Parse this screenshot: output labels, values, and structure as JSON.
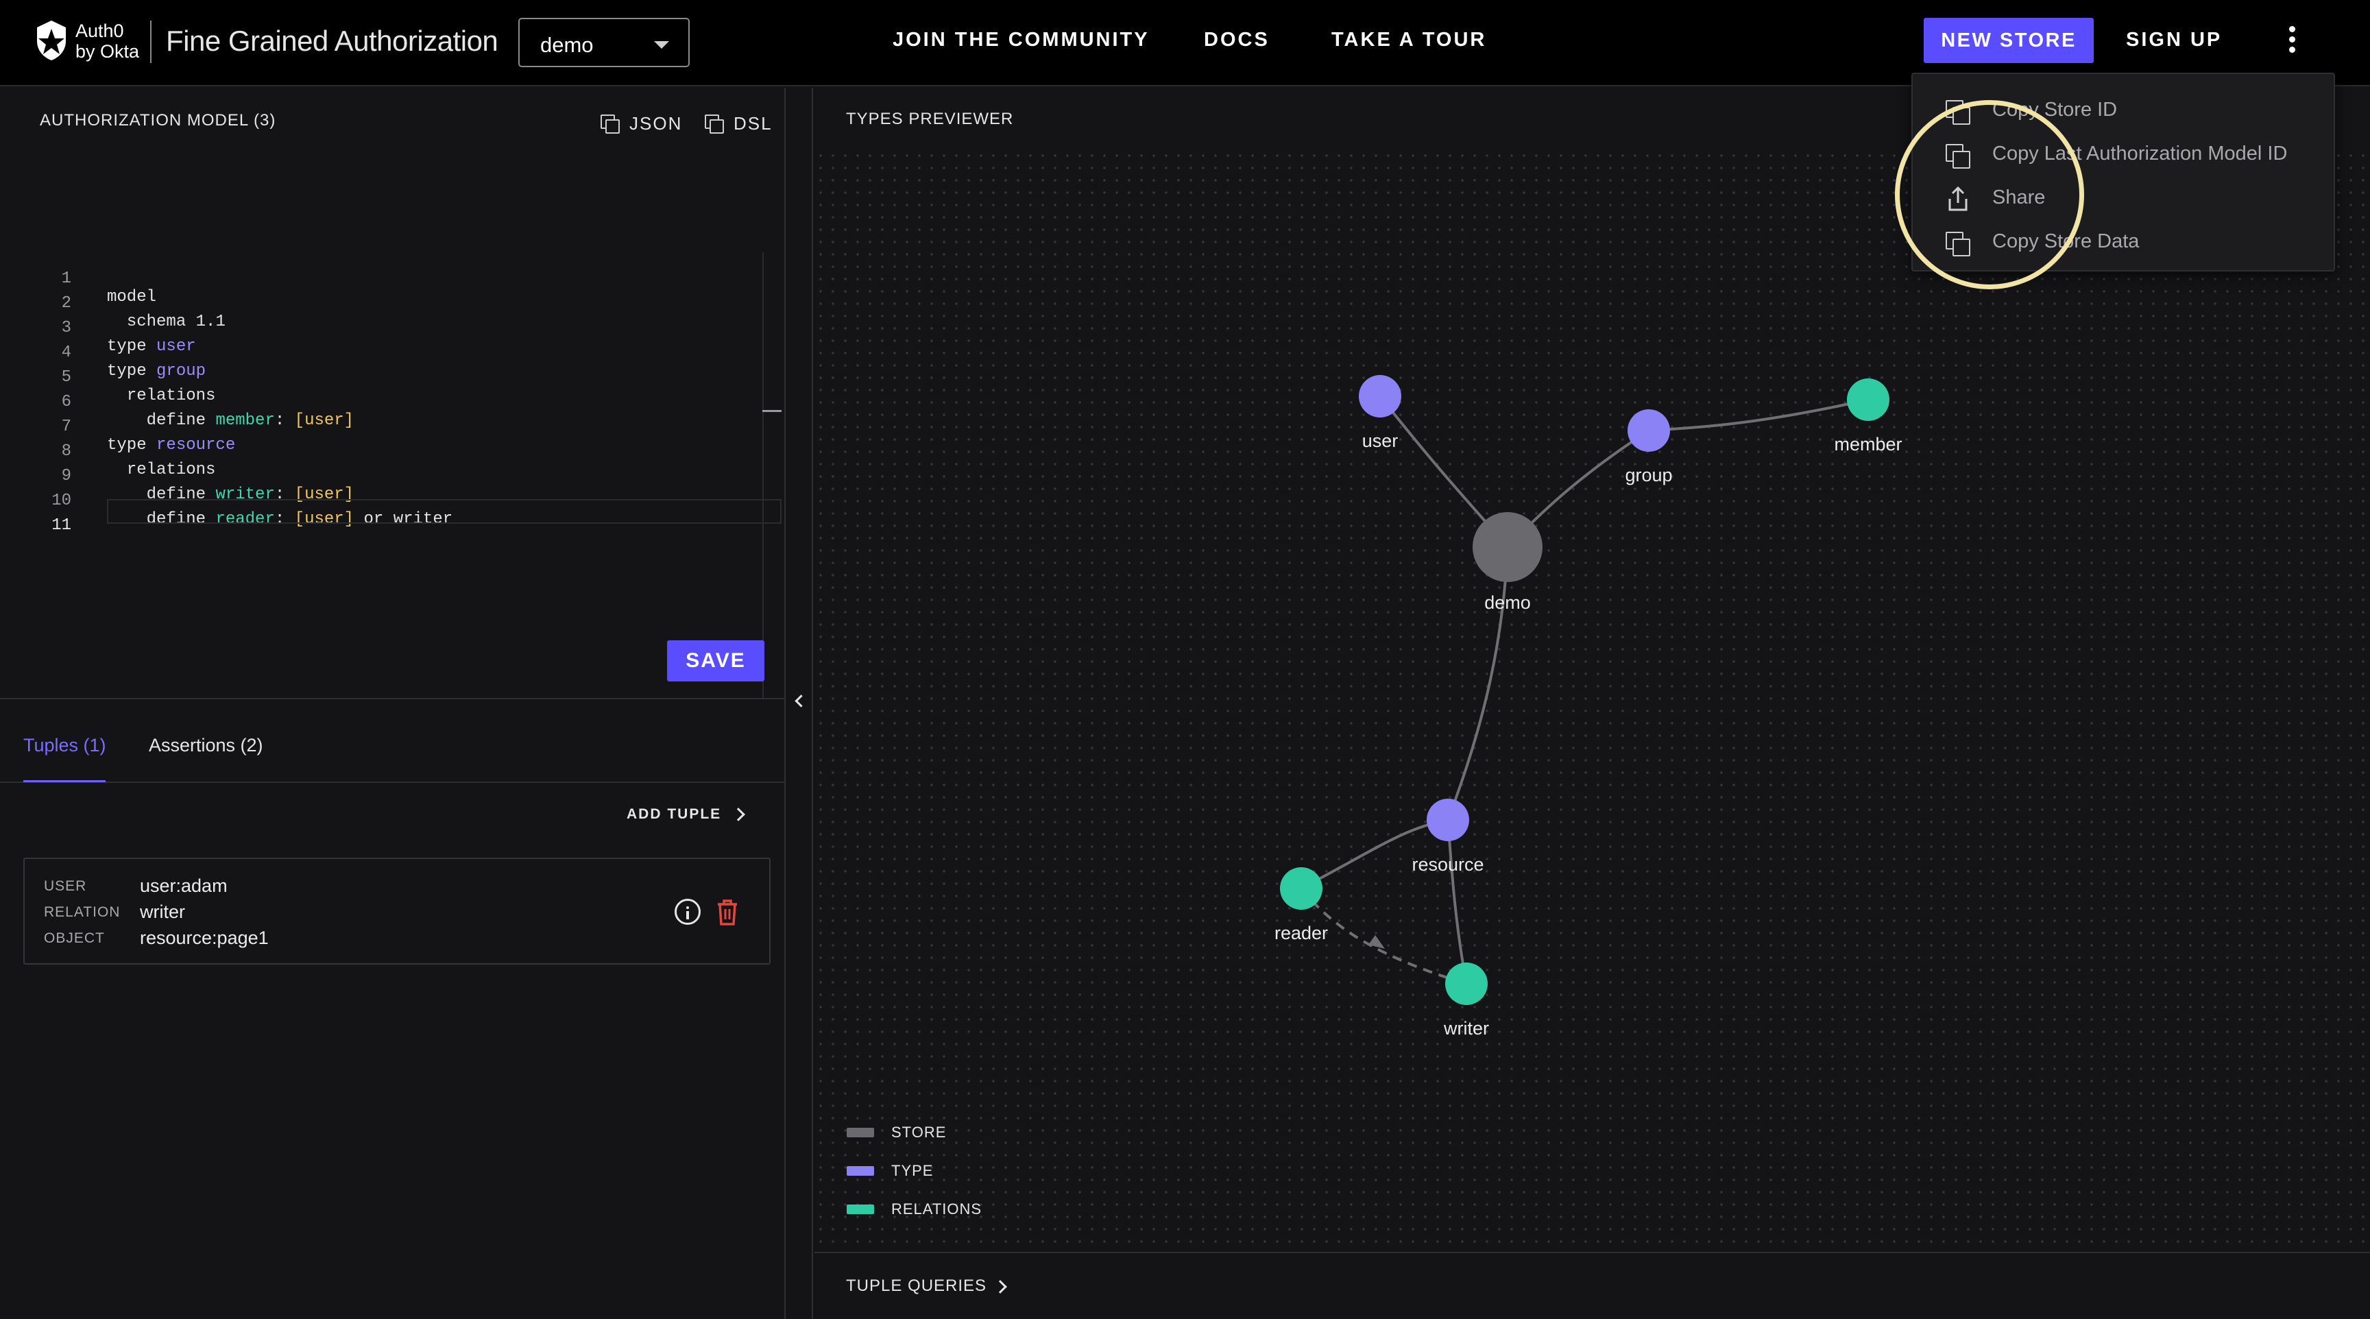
{
  "header": {
    "brand_line1": "Auth0",
    "brand_line2": "by Okta",
    "product_title": "Fine Grained Authorization",
    "store_selector_value": "demo",
    "nav": [
      "JOIN  THE COMMUNITY",
      "DOCS",
      "TAKE  A  TOUR"
    ],
    "new_store_label": "NEW STORE",
    "sign_up_label": "SIGN UP",
    "accent_color": "#5a4dff"
  },
  "model_panel": {
    "title": "AUTHORIZATION MODEL (3)",
    "json_label": "JSON",
    "dsl_label": "DSL",
    "line_numbers": [
      "1",
      "2",
      "3",
      "4",
      "5",
      "6",
      "7",
      "8",
      "9",
      "10",
      "11"
    ],
    "code": {
      "l1": "model",
      "l2_kw": "schema ",
      "l2_val": "1.1",
      "l3_kw": "type ",
      "l3_name": "user",
      "l4_kw": "type ",
      "l4_name": "group",
      "l5": "relations",
      "l6_kw": "define ",
      "l6_rel": "member",
      "l6_sep": ": ",
      "l6_val": "[user]",
      "l7_kw": "type ",
      "l7_name": "resource",
      "l8": "relations",
      "l9_kw": "define ",
      "l9_rel": "writer",
      "l9_sep": ": ",
      "l9_val": "[user]",
      "l10_kw": "define ",
      "l10_rel": "reader",
      "l10_sep": ": ",
      "l10_val": "[user]",
      "l10_rest": " or writer"
    },
    "save_label": "SAVE"
  },
  "tuples_panel": {
    "tab_tuples": "Tuples (1)",
    "tab_assertions": "Assertions (2)",
    "add_tuple_label": "ADD TUPLE",
    "tuple": {
      "user_label": "USER",
      "user_value": "user:adam",
      "relation_label": "RELATION",
      "relation_value": "writer",
      "object_label": "OBJECT",
      "object_value": "resource:page1"
    }
  },
  "types_previewer": {
    "title": "TYPES PREVIEWER",
    "colors": {
      "store": "#6a6a6e",
      "type": "#8a82f5",
      "relation": "#2fcca4",
      "edge": "#6f6f74"
    },
    "nodes": {
      "demo": "demo",
      "user": "user",
      "group": "group",
      "member": "member",
      "resource": "resource",
      "reader": "reader",
      "writer": "writer"
    },
    "legend": [
      "STORE",
      "TYPE",
      "RELATIONS"
    ],
    "tuple_queries_label": "TUPLE QUERIES"
  },
  "menu": {
    "items": [
      "Copy Store ID",
      "Copy Last Authorization Model ID",
      "Share",
      "Copy Store Data"
    ]
  }
}
